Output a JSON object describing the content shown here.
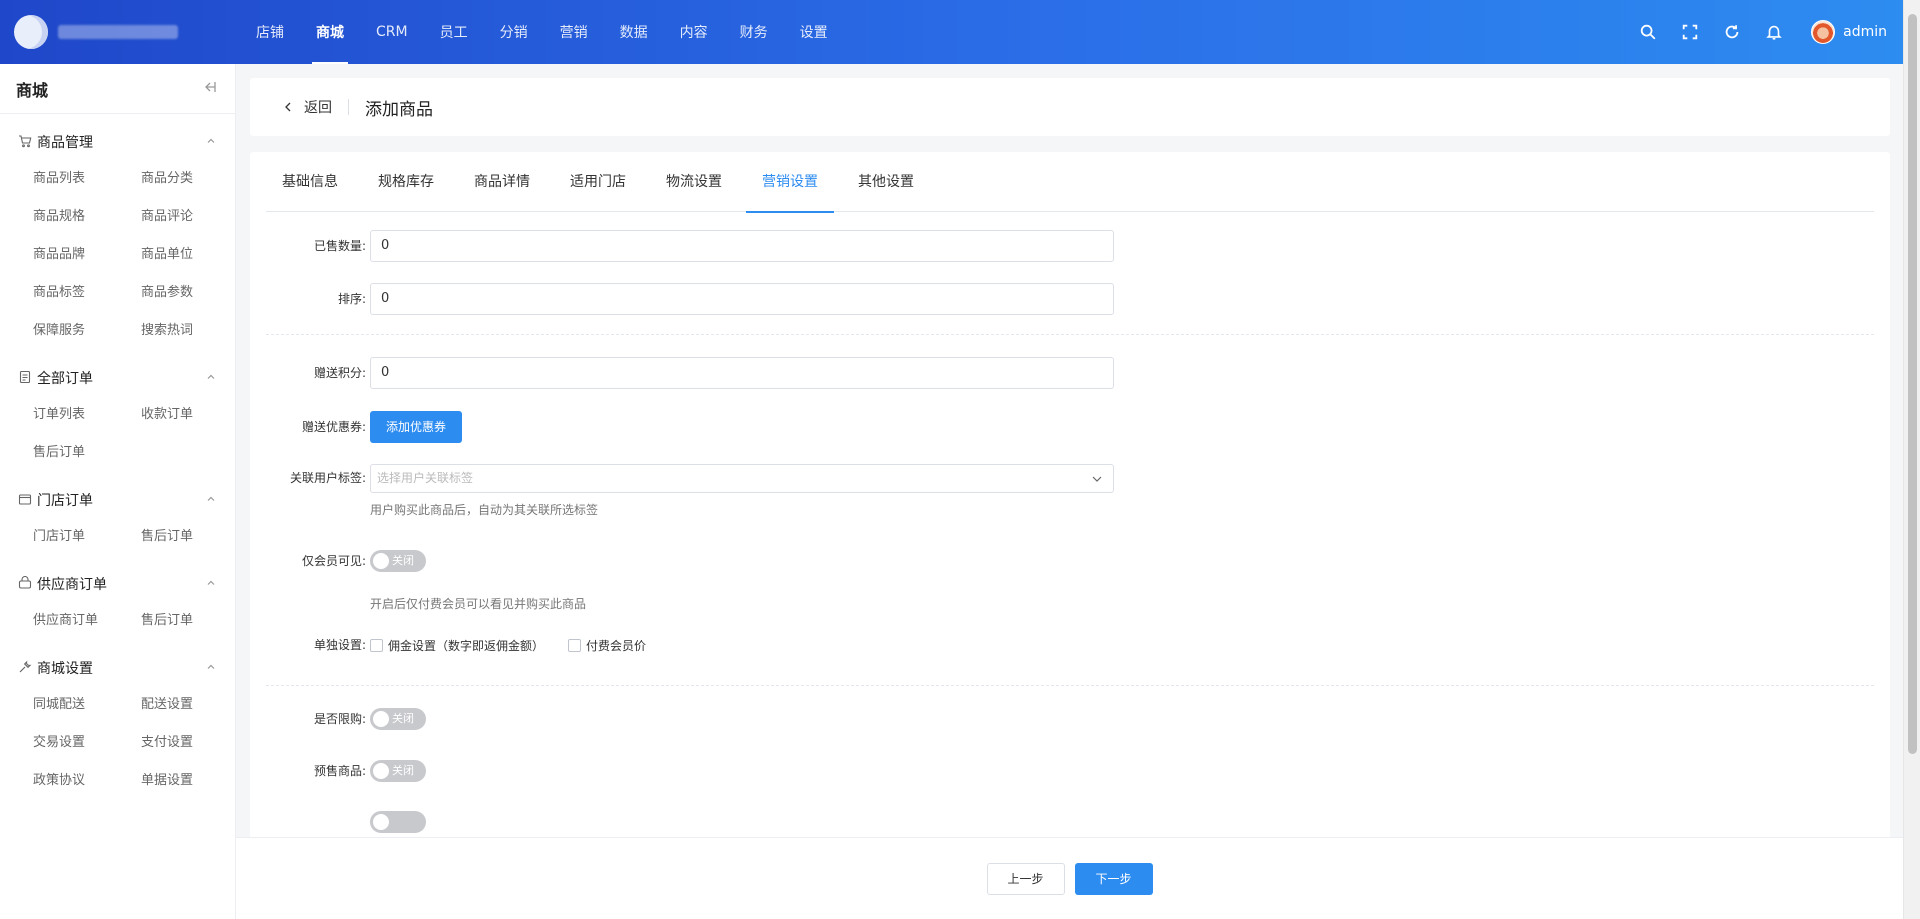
{
  "header": {
    "nav": [
      "店铺",
      "商城",
      "CRM",
      "员工",
      "分销",
      "营销",
      "数据",
      "内容",
      "财务",
      "设置"
    ],
    "active_nav": "商城",
    "user_name": "admin",
    "icons": [
      "search-icon",
      "fullscreen-icon",
      "refresh-icon",
      "bell-icon"
    ]
  },
  "sidebar": {
    "title": "商城",
    "groups": [
      {
        "label": "商品管理",
        "icon": "cart-icon",
        "items": [
          "商品列表",
          "商品分类",
          "商品规格",
          "商品评论",
          "商品品牌",
          "商品单位",
          "商品标签",
          "商品参数",
          "保障服务",
          "搜索热词"
        ]
      },
      {
        "label": "全部订单",
        "icon": "document-icon",
        "items": [
          "订单列表",
          "收款订单",
          "售后订单"
        ]
      },
      {
        "label": "门店订单",
        "icon": "store-icon",
        "items": [
          "门店订单",
          "售后订单"
        ]
      },
      {
        "label": "供应商订单",
        "icon": "supplier-icon",
        "items": [
          "供应商订单",
          "售后订单"
        ]
      },
      {
        "label": "商城设置",
        "icon": "wrench-icon",
        "items": [
          "同城配送",
          "配送设置",
          "交易设置",
          "支付设置",
          "政策协议",
          "单据设置"
        ]
      }
    ]
  },
  "page": {
    "back_label": "返回",
    "title": "添加商品"
  },
  "tabs": [
    "基础信息",
    "规格库存",
    "商品详情",
    "适用门店",
    "物流设置",
    "营销设置",
    "其他设置"
  ],
  "active_tab": "营销设置",
  "form": {
    "sold_count": {
      "label": "已售数量:",
      "value": "0"
    },
    "sort": {
      "label": "排序:",
      "value": "0"
    },
    "points": {
      "label": "赠送积分:",
      "value": "0"
    },
    "coupon": {
      "label": "赠送优惠券:",
      "button": "添加优惠券"
    },
    "user_tag": {
      "label": "关联用户标签:",
      "placeholder": "选择用户关联标签",
      "hint": "用户购买此商品后，自动为其关联所选标签"
    },
    "member_only": {
      "label": "仅会员可见:",
      "state": "关闭",
      "hint": "开启后仅付费会员可以看见并购买此商品"
    },
    "separate": {
      "label": "单独设置:",
      "options": [
        "佣金设置（数字即返佣金额）",
        "付费会员价"
      ]
    },
    "limit": {
      "label": "是否限购:",
      "state": "关闭"
    },
    "presale": {
      "label": "预售商品:",
      "state": "关闭"
    }
  },
  "footer": {
    "prev_label": "上一步",
    "next_label": "下一步"
  },
  "colors": {
    "primary": "#2d8cf0",
    "header_start": "#1f47c9",
    "header_end": "#2d8cf0",
    "switch_off": "#c8c9cc"
  }
}
